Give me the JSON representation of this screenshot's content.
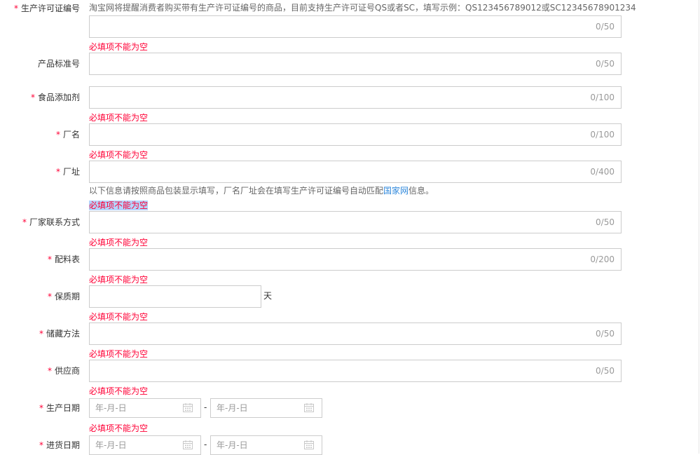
{
  "error_text": "必填项不能为空",
  "fields": {
    "license": {
      "label": "生产许可证编号",
      "required": "*",
      "hint": "淘宝网将提醒消费者购买带有生产许可证编号的商品，目前支持生产许可证号QS或者SC，填写示例：QS123456789012或SC12345678901234",
      "count": "0/50"
    },
    "standard": {
      "label": "产品标准号",
      "count": "0/50"
    },
    "additive": {
      "label": "食品添加剂",
      "required": "*",
      "count": "0/100"
    },
    "factory_name": {
      "label": "厂名",
      "required": "*",
      "count": "0/100"
    },
    "factory_address": {
      "label": "厂址",
      "required": "*",
      "count": "0/400",
      "hint_prefix": "以下信息请按照商品包装显示填写，厂名厂址会在填写生产许可证编号自动匹配",
      "hint_link": "国家网",
      "hint_suffix": "信息。"
    },
    "factory_contact": {
      "label": "厂家联系方式",
      "required": "*",
      "count": "0/50"
    },
    "ingredients": {
      "label": "配料表",
      "required": "*",
      "count": "0/200"
    },
    "shelf_life": {
      "label": "保质期",
      "required": "*",
      "unit": "天"
    },
    "storage": {
      "label": "储藏方法",
      "required": "*",
      "count": "0/50"
    },
    "supplier": {
      "label": "供应商",
      "required": "*",
      "count": "0/50"
    },
    "production_date": {
      "label": "生产日期",
      "required": "*",
      "start_placeholder": "年-月-日",
      "separator": "-",
      "end_placeholder": "年-月-日"
    },
    "purchase_date": {
      "label": "进货日期",
      "required": "*",
      "start_placeholder": "年-月-日",
      "separator": "-",
      "end_placeholder": "年-月-日"
    }
  },
  "icons": {
    "calendar": "calendar-icon"
  },
  "colors": {
    "required": "#ff0036",
    "error": "#ff0036",
    "link": "#3089dc",
    "border": "#cccccc",
    "counter": "#999999",
    "selection": "#b4d5fe"
  }
}
